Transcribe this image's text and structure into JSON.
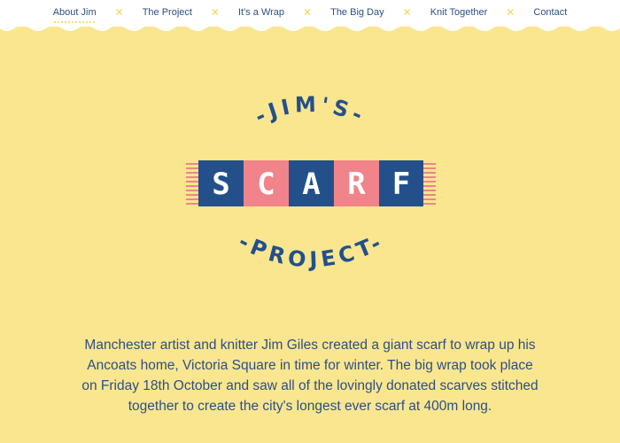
{
  "nav": {
    "items": [
      {
        "label": "About Jim",
        "active": true
      },
      {
        "label": "The Project"
      },
      {
        "label": "It's a Wrap"
      },
      {
        "label": "The Big Day"
      },
      {
        "label": "Knit Together"
      },
      {
        "label": "Contact"
      }
    ],
    "separator": "✕"
  },
  "logo": {
    "top_text": "-JIM'S-",
    "scarf_letters": [
      "S",
      "C",
      "A",
      "R",
      "F"
    ],
    "bottom_text": "-PROJECT-"
  },
  "intro": {
    "text": "Manchester artist and knitter Jim Giles created a giant scarf to wrap up his Ancoats home, Victoria Square in time for winter. The big wrap took place on Friday 18th October and saw all of the lovingly donated scarves stitched together to create the city's longest ever scarf at 400m long."
  },
  "colors": {
    "background": "#f9e68f",
    "navy": "#23508a",
    "pink": "#f0848a",
    "accent_yellow": "#f2d65e"
  }
}
